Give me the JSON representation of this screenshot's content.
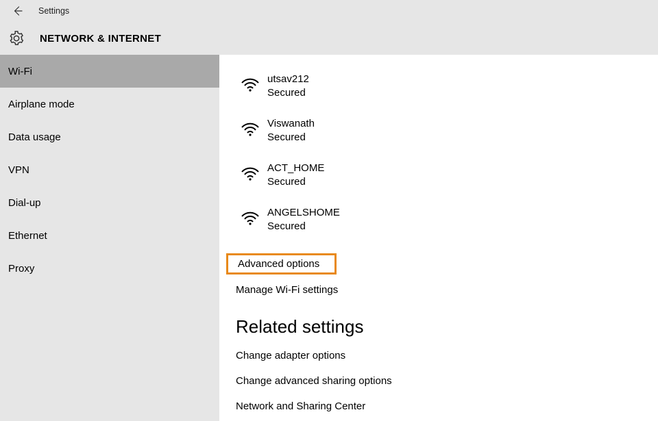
{
  "topbar": {
    "title": "Settings"
  },
  "header": {
    "title": "NETWORK & INTERNET"
  },
  "sidebar": {
    "items": [
      {
        "label": "Wi-Fi",
        "selected": true
      },
      {
        "label": "Airplane mode",
        "selected": false
      },
      {
        "label": "Data usage",
        "selected": false
      },
      {
        "label": "VPN",
        "selected": false
      },
      {
        "label": "Dial-up",
        "selected": false
      },
      {
        "label": "Ethernet",
        "selected": false
      },
      {
        "label": "Proxy",
        "selected": false
      }
    ]
  },
  "networks": [
    {
      "name": "utsav212",
      "status": "Secured"
    },
    {
      "name": "Viswanath",
      "status": "Secured"
    },
    {
      "name": "ACT_HOME",
      "status": "Secured"
    },
    {
      "name": "ANGELSHOME",
      "status": "Secured"
    }
  ],
  "links": {
    "advanced": "Advanced options",
    "manage": "Manage Wi-Fi settings"
  },
  "related": {
    "title": "Related settings",
    "items": [
      "Change adapter options",
      "Change advanced sharing options",
      "Network and Sharing Center"
    ]
  }
}
